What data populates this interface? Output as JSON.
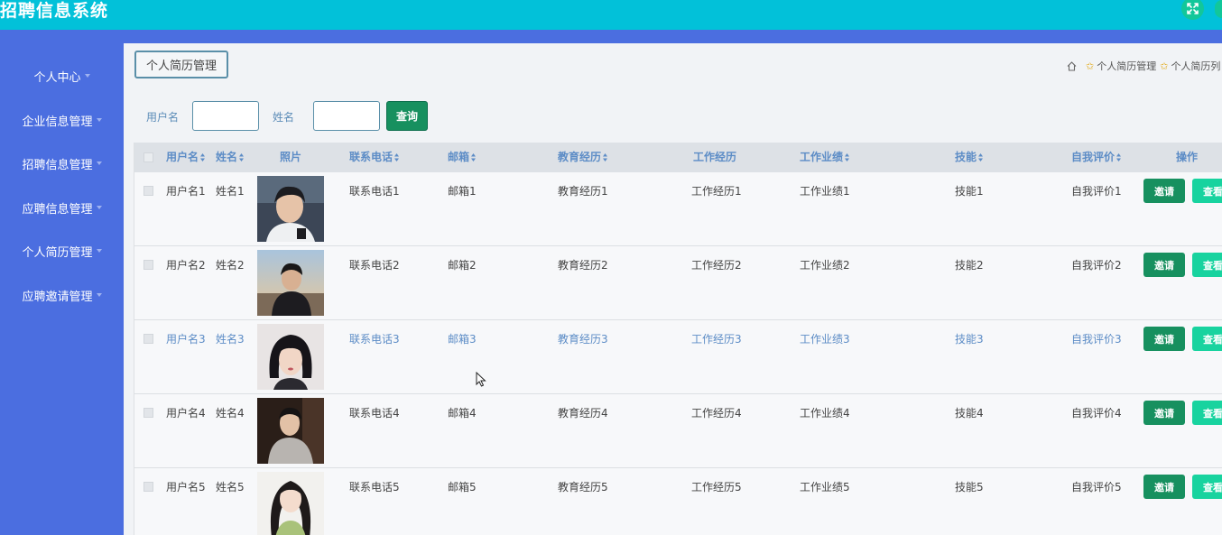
{
  "app": {
    "title": "招聘信息系统",
    "fullscreen_icon": "fullscreen-icon"
  },
  "sidebar": {
    "items": [
      {
        "label": "个人中心"
      },
      {
        "label": "企业信息管理"
      },
      {
        "label": "招聘信息管理"
      },
      {
        "label": "应聘信息管理"
      },
      {
        "label": "个人简历管理"
      },
      {
        "label": "应聘邀请管理"
      }
    ]
  },
  "page": {
    "title": "个人简历管理",
    "breadcrumb": [
      "个人简历管理",
      "个人简历列"
    ]
  },
  "search": {
    "username_label": "用户名",
    "username_value": "",
    "name_label": "姓名",
    "name_value": "",
    "query_label": "查询"
  },
  "table": {
    "headers": {
      "username": "用户名",
      "name": "姓名",
      "photo": "照片",
      "phone": "联系电话",
      "email": "邮箱",
      "education": "教育经历",
      "work": "工作经历",
      "achievement": "工作业绩",
      "skill": "技能",
      "evaluation": "自我评价",
      "action": "操作"
    },
    "invite_label": "邀请",
    "view_label": "查看",
    "rows": [
      {
        "username": "用户名1",
        "name": "姓名1",
        "phone": "联系电话1",
        "email": "邮箱1",
        "education": "教育经历1",
        "work": "工作经历1",
        "achievement": "工作业绩1",
        "skill": "技能1",
        "evaluation": "自我评价1",
        "photo_desc": "young man with black hair in white shirt"
      },
      {
        "username": "用户名2",
        "name": "姓名2",
        "phone": "联系电话2",
        "email": "邮箱2",
        "education": "教育经历2",
        "work": "工作经历2",
        "achievement": "工作业绩2",
        "skill": "技能2",
        "evaluation": "自我评价2",
        "photo_desc": "man in dark coat outdoors at sunset"
      },
      {
        "username": "用户名3",
        "name": "姓名3",
        "phone": "联系电话3",
        "email": "邮箱3",
        "education": "教育经历3",
        "work": "工作经历3",
        "achievement": "工作业绩3",
        "skill": "技能3",
        "evaluation": "自我评价3",
        "photo_desc": "woman with black bob hair"
      },
      {
        "username": "用户名4",
        "name": "姓名4",
        "phone": "联系电话4",
        "email": "邮箱4",
        "education": "教育经历4",
        "work": "工作经历4",
        "achievement": "工作业绩4",
        "skill": "技能4",
        "evaluation": "自我评价4",
        "photo_desc": "young man in grey sweater"
      },
      {
        "username": "用户名5",
        "name": "姓名5",
        "phone": "联系电话5",
        "email": "邮箱5",
        "education": "教育经历5",
        "work": "工作经历5",
        "achievement": "工作业绩5",
        "skill": "技能5",
        "evaluation": "自我评价5",
        "photo_desc": "girl with long hair in green top"
      }
    ]
  },
  "colors": {
    "topbar": "#02c1d9",
    "sidebar": "#4b6ee0",
    "invite_button": "#17905f",
    "view_button": "#18d39f",
    "header_text": "#5c8cc6"
  }
}
